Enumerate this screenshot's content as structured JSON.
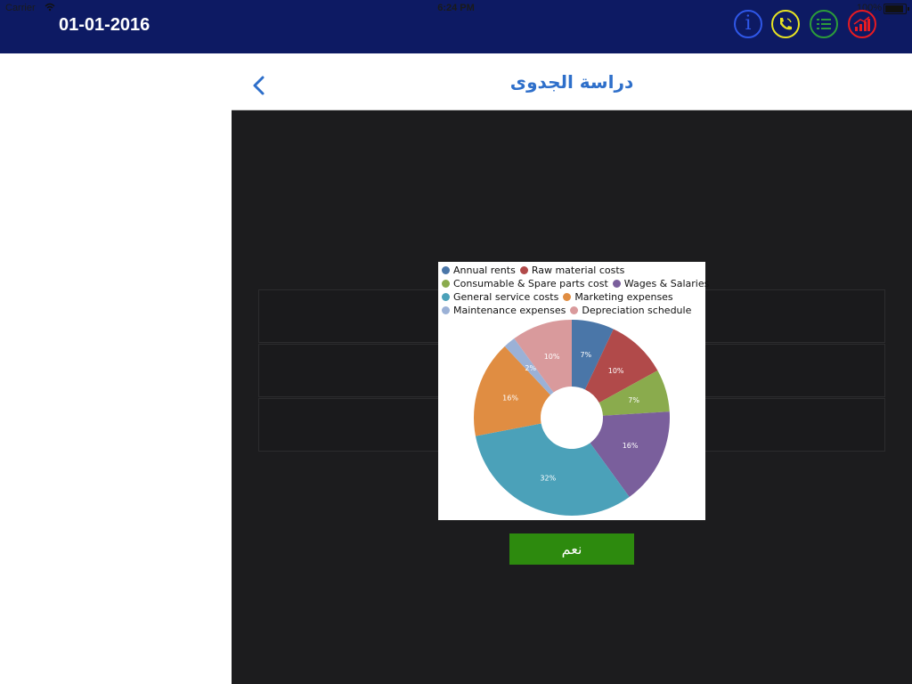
{
  "status_bar": {
    "carrier": "Carrier",
    "time": "6:24 PM",
    "battery": "100%"
  },
  "header": {
    "date": "01-01-2016",
    "icons": [
      "info-icon",
      "phone-icon",
      "list-icon",
      "chart-icon"
    ],
    "colors": {
      "info": "#2f57e8",
      "phone": "#e6e223",
      "list": "#2c9c3a",
      "chart": "#e81b22",
      "bar": "#0d1a63"
    }
  },
  "nav": {
    "title": "دراسة الجدوى",
    "back_icon": "chevron-left-icon"
  },
  "dialog": {
    "ok_label": "نعم"
  },
  "chart_data": {
    "type": "pie",
    "donut": true,
    "categories": [
      "Annual rents",
      "Raw material costs",
      "Consumable & Spare parts cost",
      "Wages & Salaries",
      "General service costs",
      "Marketing expenses",
      "Maintenance expenses",
      "Depreciation schedule"
    ],
    "values": [
      7,
      10,
      7,
      16,
      32,
      16,
      2,
      10
    ],
    "labels": [
      "7%",
      "10%",
      "7%",
      "16%",
      "32%",
      "16%",
      "2%",
      "10%"
    ],
    "colors": [
      "#4a76a8",
      "#b14a4a",
      "#8aab4d",
      "#7a5f9c",
      "#4ba1b9",
      "#e08d42",
      "#9bb1d6",
      "#d99a9c"
    ],
    "legend_position": "top"
  }
}
